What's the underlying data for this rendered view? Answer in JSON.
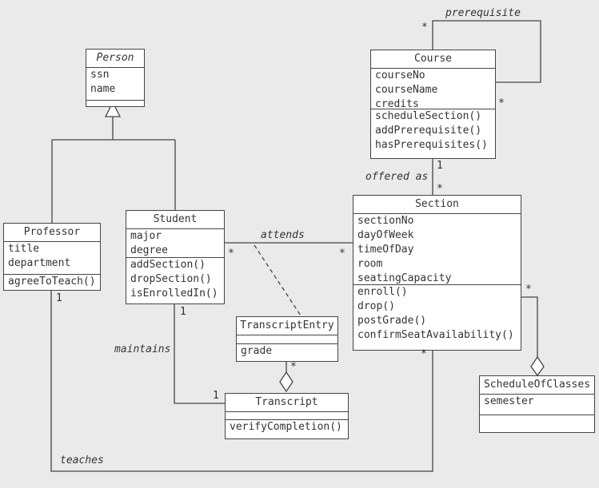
{
  "classes": [
    {
      "id": "person",
      "name": "Person",
      "abstract": true,
      "attributes": [
        "ssn",
        "name"
      ],
      "operations": []
    },
    {
      "id": "professor",
      "name": "Professor",
      "abstract": false,
      "attributes": [
        "title",
        "department"
      ],
      "operations": [
        "agreeToTeach()"
      ]
    },
    {
      "id": "student",
      "name": "Student",
      "abstract": false,
      "attributes": [
        "major",
        "degree"
      ],
      "operations": [
        "addSection()",
        "dropSection()",
        "isEnrolledIn()"
      ]
    },
    {
      "id": "course",
      "name": "Course",
      "abstract": false,
      "attributes": [
        "courseNo",
        "courseName",
        "credits"
      ],
      "operations": [
        "scheduleSection()",
        "addPrerequisite()",
        "hasPrerequisites()"
      ]
    },
    {
      "id": "section",
      "name": "Section",
      "abstract": false,
      "attributes": [
        "sectionNo",
        "dayOfWeek",
        "timeOfDay",
        "room",
        "seatingCapacity"
      ],
      "operations": [
        "enroll()",
        "drop()",
        "postGrade()",
        "confirmSeatAvailability()"
      ]
    },
    {
      "id": "transcriptentry",
      "name": "TranscriptEntry",
      "abstract": false,
      "attributes": [],
      "operations": [
        "grade"
      ]
    },
    {
      "id": "transcript",
      "name": "Transcript",
      "abstract": false,
      "attributes": [],
      "operations": [
        "verifyCompletion()"
      ]
    },
    {
      "id": "scheduleofclasses",
      "name": "ScheduleOfClasses",
      "abstract": false,
      "attributes": [
        "semester"
      ],
      "operations": []
    }
  ],
  "associations": [
    {
      "id": "prerequisite",
      "label": "prerequisite",
      "multiplicities": [
        "*",
        "*"
      ]
    },
    {
      "id": "offered-as",
      "label": "offered as",
      "multiplicities": [
        "1",
        "*"
      ]
    },
    {
      "id": "attends",
      "label": "attends",
      "multiplicities": [
        "*",
        "*"
      ]
    },
    {
      "id": "maintains",
      "label": "maintains",
      "multiplicities": [
        "1",
        "1"
      ]
    },
    {
      "id": "teaches",
      "label": "teaches",
      "multiplicities": [
        "1",
        "*"
      ]
    },
    {
      "id": "transcript-aggregation",
      "label": "",
      "multiplicities": [
        "*"
      ]
    },
    {
      "id": "schedule-aggregation",
      "label": "",
      "multiplicities": [
        "*"
      ]
    }
  ]
}
